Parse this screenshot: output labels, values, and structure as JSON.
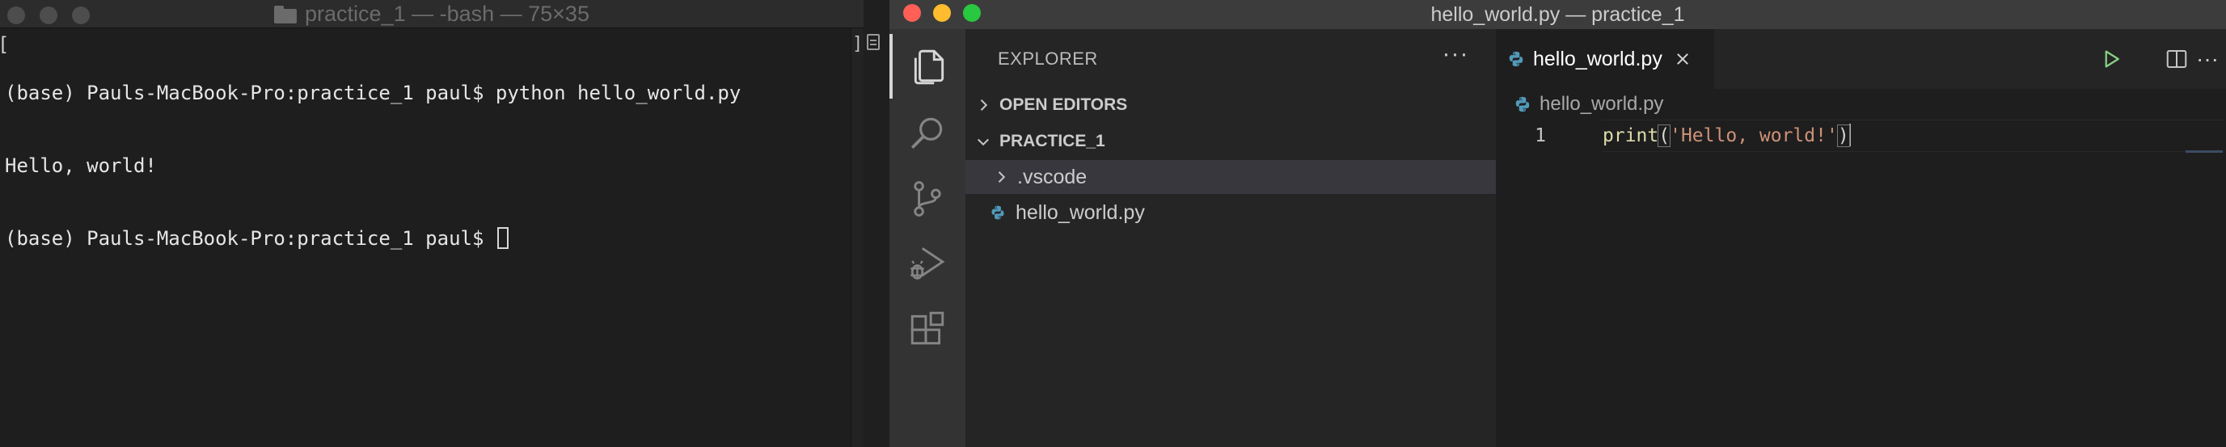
{
  "terminal": {
    "title": "practice_1 — -bash — 75×35",
    "lines": [
      "(base) Pauls-MacBook-Pro:practice_1 paul$ python hello_world.py",
      "Hello, world!",
      "(base) Pauls-MacBook-Pro:practice_1 paul$ "
    ]
  },
  "vscode": {
    "title": "hello_world.py — practice_1",
    "activity_bar": [
      "files-icon",
      "search-icon",
      "source-control-icon",
      "run-debug-icon",
      "extensions-icon"
    ],
    "explorer": {
      "title": "EXPLORER",
      "more": "···",
      "sections": {
        "open_editors": "OPEN EDITORS",
        "folder": "PRACTICE_1"
      },
      "items": [
        {
          "label": ".vscode",
          "type": "folder"
        },
        {
          "label": "hello_world.py",
          "type": "python-file"
        }
      ]
    },
    "editor": {
      "tab_label": "hello_world.py",
      "breadcrumb": "hello_world.py",
      "line_number": "1",
      "code": {
        "fn": "print",
        "open_paren": "(",
        "string": "'Hello, world!'",
        "close_paren": ")"
      },
      "actions": [
        "run-icon",
        "split-editor-icon",
        "more-actions-icon"
      ],
      "more_actions": "···"
    },
    "colors": {
      "title_bar": "#3c3c3c",
      "activity_bar": "#333333",
      "sidebar": "#252526",
      "editor": "#1e1e1e",
      "selection": "#37373d",
      "run_green": "#89d185",
      "python_blue": "#519aba"
    }
  }
}
